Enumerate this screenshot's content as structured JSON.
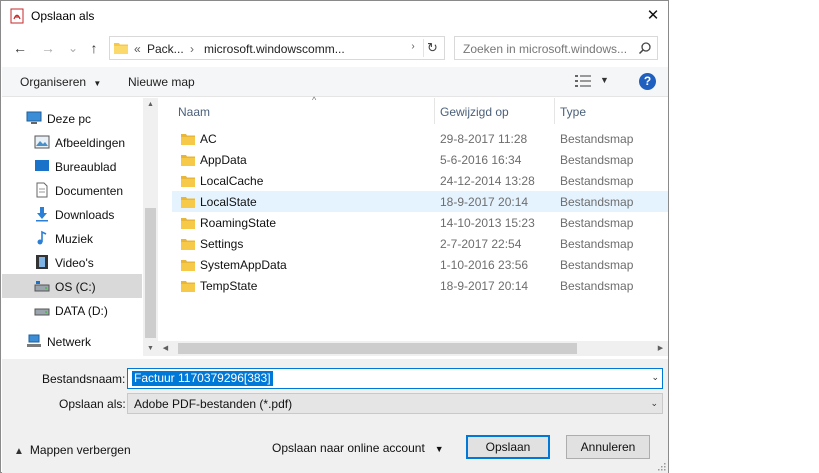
{
  "window": {
    "title": "Opslaan als",
    "close_glyph": "✕"
  },
  "nav": {
    "back": "←",
    "forward": "→",
    "recent": "⌄",
    "up": "↑"
  },
  "address": {
    "overflow": "«",
    "segments": [
      "Pack...",
      "microsoft.windowscomm..."
    ],
    "separator": "›",
    "dropdown": "›",
    "refresh": "↻"
  },
  "search": {
    "placeholder": "Zoeken in microsoft.windows..."
  },
  "commandbar": {
    "organize": "Organiseren",
    "organize_dd": "▼",
    "new_folder": "Nieuwe map",
    "view_dd": "▼",
    "help": "?"
  },
  "sidebar": {
    "items": [
      {
        "label": "Deze pc",
        "icon": "pc-icon"
      },
      {
        "label": "Afbeeldingen",
        "icon": "pictures-icon"
      },
      {
        "label": "Bureaublad",
        "icon": "desktop-icon"
      },
      {
        "label": "Documenten",
        "icon": "documents-icon"
      },
      {
        "label": "Downloads",
        "icon": "downloads-icon"
      },
      {
        "label": "Muziek",
        "icon": "music-icon"
      },
      {
        "label": "Video's",
        "icon": "videos-icon"
      },
      {
        "label": "OS (C:)",
        "icon": "drive-icon",
        "selected": true
      },
      {
        "label": "DATA (D:)",
        "icon": "drive-icon"
      },
      {
        "label": "Netwerk",
        "icon": "network-icon"
      }
    ]
  },
  "filelist": {
    "columns": {
      "name": "Naam",
      "modified": "Gewijzigd op",
      "type": "Type"
    },
    "sort_glyph": "^",
    "rows": [
      {
        "name": "AC",
        "modified": "29-8-2017 11:28",
        "type": "Bestandsmap"
      },
      {
        "name": "AppData",
        "modified": "5-6-2016 16:34",
        "type": "Bestandsmap"
      },
      {
        "name": "LocalCache",
        "modified": "24-12-2014 13:28",
        "type": "Bestandsmap"
      },
      {
        "name": "LocalState",
        "modified": "18-9-2017 20:14",
        "type": "Bestandsmap"
      },
      {
        "name": "RoamingState",
        "modified": "14-10-2013 15:23",
        "type": "Bestandsmap"
      },
      {
        "name": "Settings",
        "modified": "2-7-2017 22:54",
        "type": "Bestandsmap"
      },
      {
        "name": "SystemAppData",
        "modified": "1-10-2016 23:56",
        "type": "Bestandsmap"
      },
      {
        "name": "TempState",
        "modified": "18-9-2017 20:14",
        "type": "Bestandsmap"
      }
    ]
  },
  "scroll": {
    "up": "▲",
    "down": "▼",
    "left": "◀",
    "right": "▶"
  },
  "save": {
    "filename_label": "Bestandsnaam:",
    "filename_value": "Factuur 1170379296[383]",
    "filetype_label": "Opslaan als:",
    "filetype_value": "Adobe PDF-bestanden (*.pdf)",
    "dropdown_glyph": "⌄"
  },
  "footer": {
    "hide_folders": "Mappen verbergen",
    "hide_chevron": "▲",
    "online": "Opslaan naar online account",
    "online_dd": "▼",
    "save_button": "Opslaan",
    "cancel_button": "Annuleren"
  },
  "colors": {
    "accent": "#0078d7",
    "folder": "#f7c948",
    "selected_row": "#d9d9d9",
    "hover_row": "#e5f3ff"
  }
}
